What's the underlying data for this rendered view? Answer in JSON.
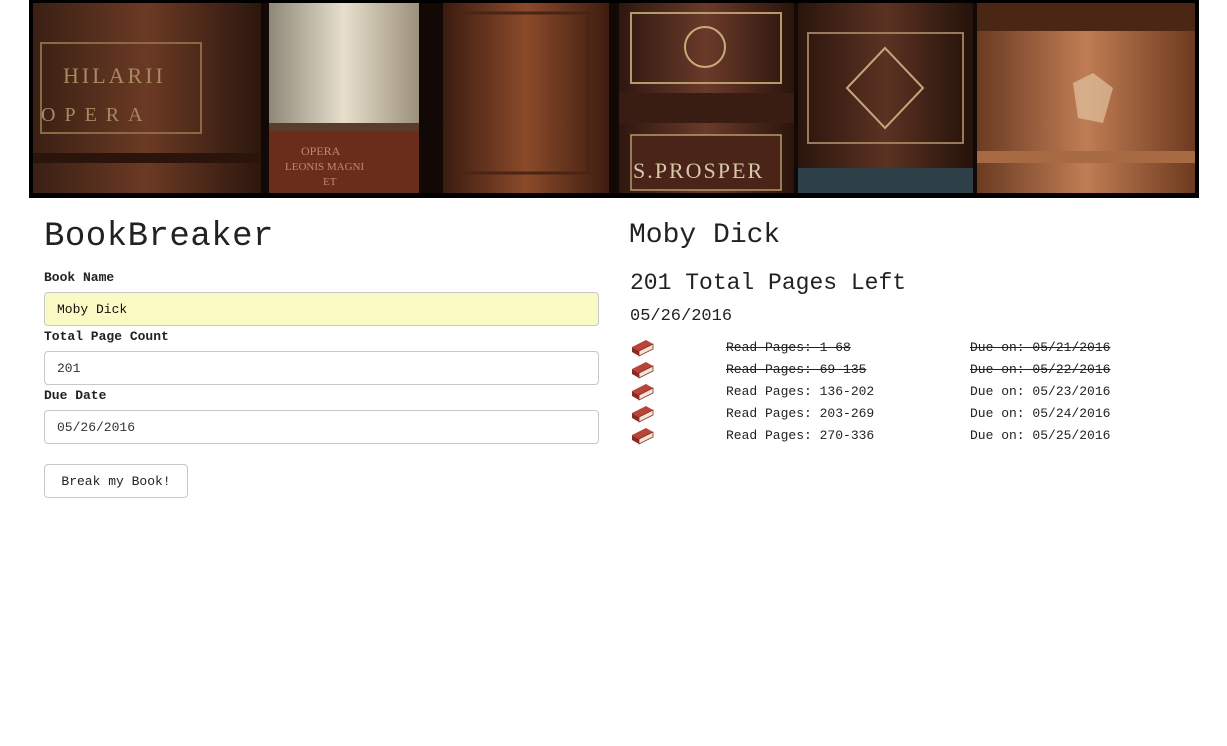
{
  "app": {
    "title": "BookBreaker"
  },
  "form": {
    "book_name": {
      "label": "Book Name",
      "value": "Moby Dick"
    },
    "total_pages": {
      "label": "Total Page Count",
      "value": "201"
    },
    "due_date": {
      "label": "Due Date",
      "value": "05/26/2016"
    },
    "submit_label": "Break my Book!"
  },
  "result": {
    "book_title": "Moby Dick",
    "pages_left_count": "201",
    "pages_left_text": "Total Pages Left",
    "due_date": "05/26/2016",
    "schedule": [
      {
        "pages": "Read Pages: 1-68",
        "due": "Due on: 05/21/2016",
        "completed": true
      },
      {
        "pages": "Read Pages: 69-135",
        "due": "Due on: 05/22/2016",
        "completed": true
      },
      {
        "pages": "Read Pages: 136-202",
        "due": "Due on: 05/23/2016",
        "completed": false
      },
      {
        "pages": "Read Pages: 203-269",
        "due": "Due on: 05/24/2016",
        "completed": false
      },
      {
        "pages": "Read Pages: 270-336",
        "due": "Due on: 05/25/2016",
        "completed": false
      }
    ],
    "icon": "book-icon"
  },
  "colors": {
    "filled_input": "#fbf9c4",
    "book_red": "#a8372e"
  }
}
